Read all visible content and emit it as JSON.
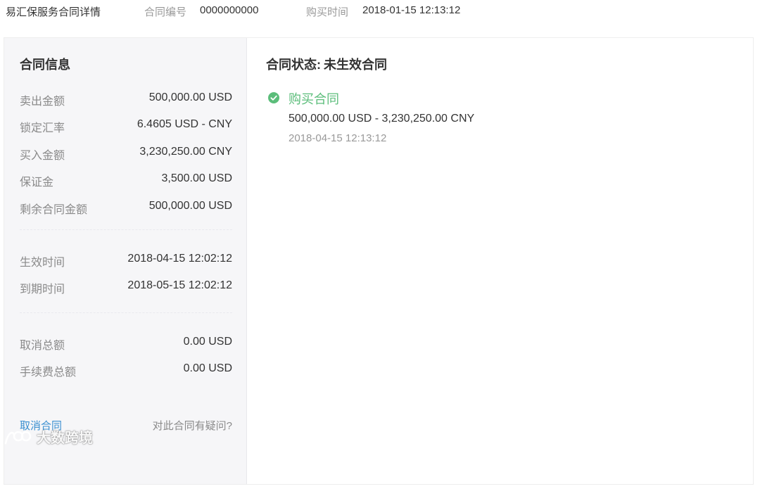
{
  "header": {
    "title": "易汇保服务合同详情",
    "contract_no_label": "合同编号",
    "contract_no": "0000000000",
    "purchase_time_label": "购买时间",
    "purchase_time": "2018-01-15 12:13:12"
  },
  "info": {
    "title": "合同信息",
    "amounts": [
      {
        "label": "卖出金额",
        "value": "500,000.00 USD"
      },
      {
        "label": "锁定汇率",
        "value": "6.4605 USD - CNY"
      },
      {
        "label": "买入金额",
        "value": "3,230,250.00 CNY"
      },
      {
        "label": "保证金",
        "value": "3,500.00 USD"
      },
      {
        "label": "剩余合同金额",
        "value": "500,000.00 USD"
      }
    ],
    "dates": [
      {
        "label": "生效时间",
        "value": "2018-04-15 12:02:12"
      },
      {
        "label": "到期时间",
        "value": "2018-05-15 12:02:12"
      }
    ],
    "totals": [
      {
        "label": "取消总额",
        "value": "0.00 USD"
      },
      {
        "label": "手续费总额",
        "value": "0.00 USD"
      }
    ],
    "cancel_link": "取消合同",
    "question_link": "对此合同有疑问?"
  },
  "status": {
    "label": "合同状态:",
    "value": "未生效合同",
    "timeline": [
      {
        "title": "购买合同",
        "detail": "500,000.00 USD - 3,230,250.00 CNY",
        "time": "2018-04-15 12:13:12",
        "icon": "check-circle-icon",
        "color": "#5bbd7a"
      }
    ]
  },
  "watermark": {
    "text": "大数跨境"
  }
}
